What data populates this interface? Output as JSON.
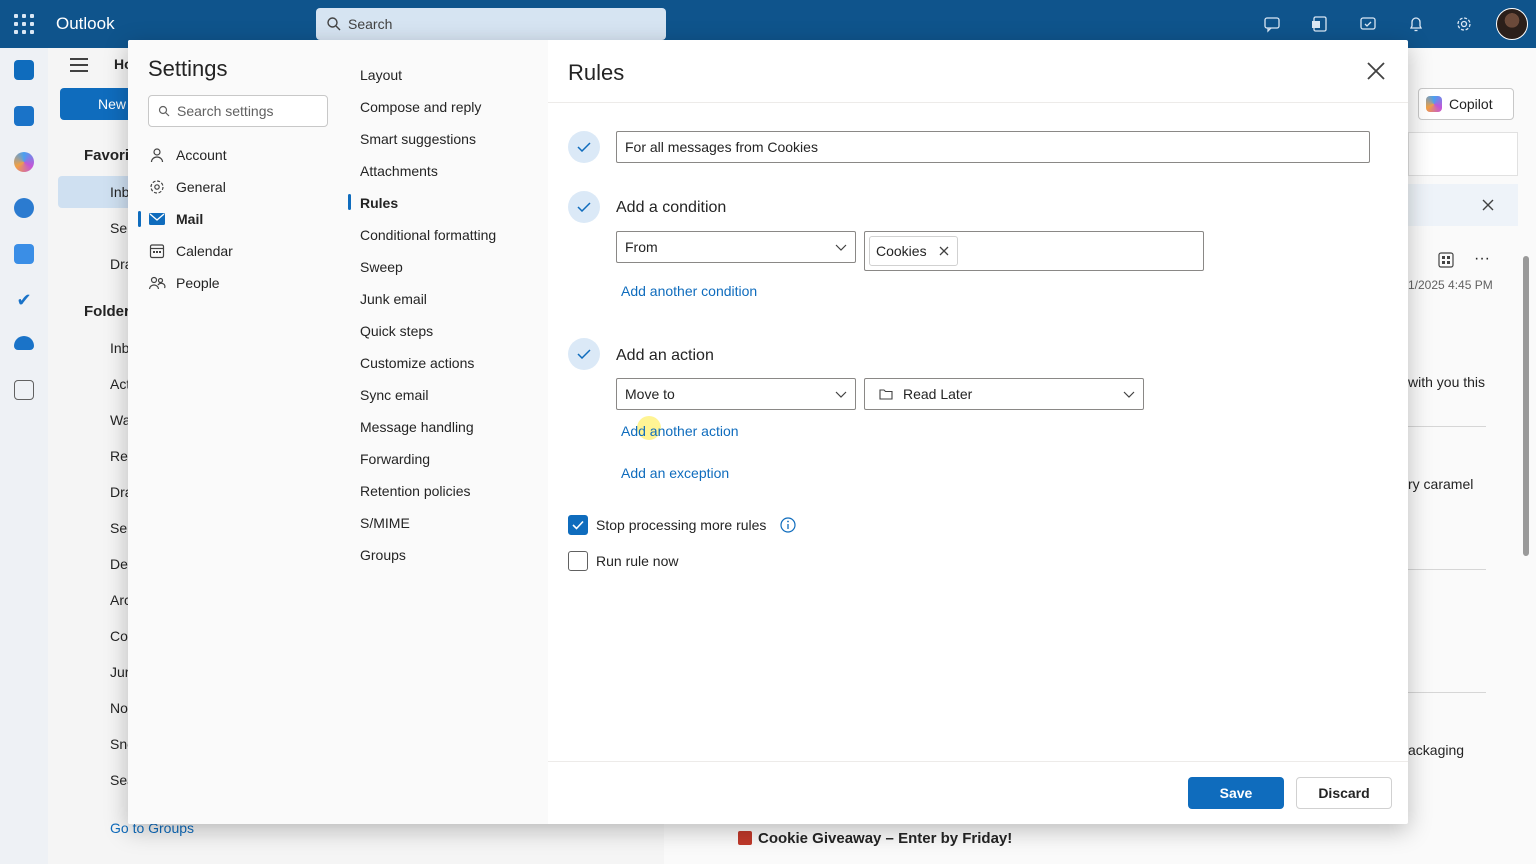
{
  "app": {
    "title": "Outlook",
    "search_placeholder": "Search"
  },
  "background": {
    "nav": {
      "home_tab": "Ho",
      "new_button": "New",
      "favorites": "Favori",
      "fav_items": [
        "Inb",
        "Se",
        "Dra"
      ],
      "folders": "Folder",
      "folder_items": [
        "Inb",
        "Act",
        "Wa",
        "Rea",
        "Dra",
        "Se",
        "Del",
        "Arc",
        "Co",
        "Jur",
        "No",
        "Sno",
        "Sea"
      ],
      "go_to_groups": "Go to Groups"
    },
    "reading": {
      "copilot_label": "Copilot",
      "date": "1/2025 4:45 PM",
      "snippet1": "with you this",
      "snippet2": "ry caramel",
      "snippet3": "ackaging",
      "giveaway": "Cookie Giveaway – Enter by Friday!"
    }
  },
  "settings": {
    "title": "Settings",
    "search_placeholder": "Search settings",
    "categories": [
      {
        "label": "Account",
        "icon": "person-icon"
      },
      {
        "label": "General",
        "icon": "gear-icon"
      },
      {
        "label": "Mail",
        "icon": "mail-icon",
        "active": true
      },
      {
        "label": "Calendar",
        "icon": "calendar-icon"
      },
      {
        "label": "People",
        "icon": "people-icon"
      }
    ],
    "mail_sections": [
      "Layout",
      "Compose and reply",
      "Smart suggestions",
      "Attachments",
      "Rules",
      "Conditional formatting",
      "Sweep",
      "Junk email",
      "Quick steps",
      "Customize actions",
      "Sync email",
      "Message handling",
      "Forwarding",
      "Retention policies",
      "S/MIME",
      "Groups"
    ],
    "active_section": "Rules"
  },
  "rules": {
    "title": "Rules",
    "rule_name": "For all messages from Cookies",
    "condition_label": "Add a condition",
    "condition_field": "From",
    "condition_value": "Cookies",
    "add_condition_link": "Add another condition",
    "action_label": "Add an action",
    "action_field": "Move to",
    "action_folder": "Read Later",
    "add_action_link": "Add another action",
    "add_exception_link": "Add an exception",
    "stop_processing_label": "Stop processing more rules",
    "stop_processing_checked": true,
    "run_now_label": "Run rule now",
    "run_now_checked": false,
    "save_label": "Save",
    "discard_label": "Discard"
  },
  "colors": {
    "brand": "#0f548c",
    "accent": "#0f6cbd"
  }
}
